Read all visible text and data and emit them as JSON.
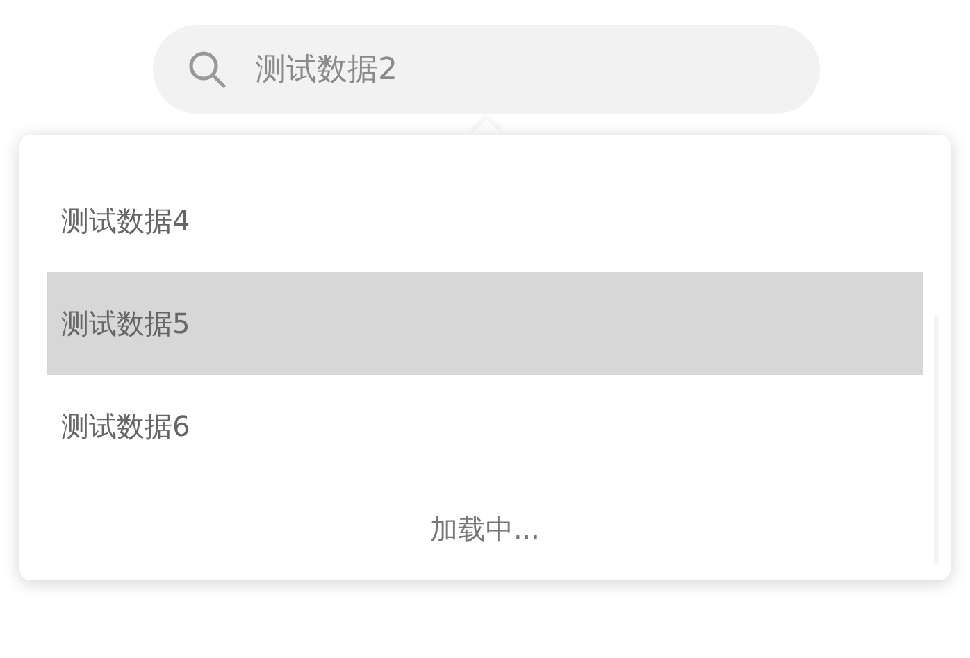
{
  "search": {
    "value": "测试数据2"
  },
  "dropdown": {
    "items": [
      {
        "label": "测试数据4",
        "selected": false
      },
      {
        "label": "测试数据5",
        "selected": true
      },
      {
        "label": "测试数据6",
        "selected": false
      }
    ],
    "loading": "加载中..."
  }
}
